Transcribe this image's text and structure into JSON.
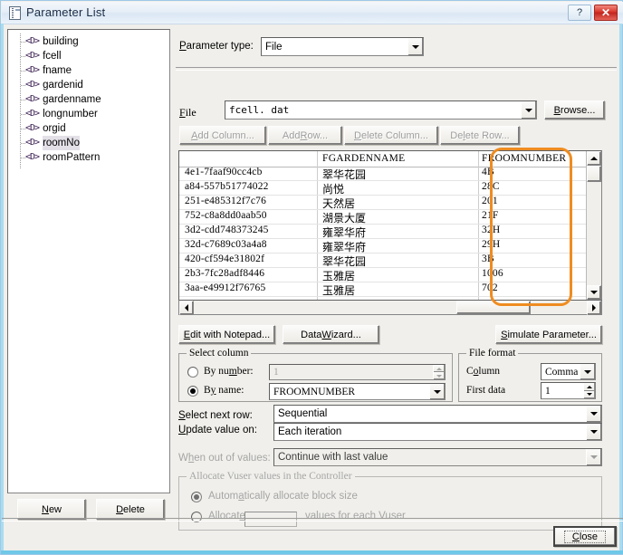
{
  "window": {
    "title": "Parameter List",
    "icon": "parameter-list-icon",
    "help_button": "?",
    "close_button": "✕"
  },
  "tree": {
    "items": [
      {
        "label": "building",
        "icon": "parameter-icon",
        "selected": false
      },
      {
        "label": "fcell",
        "icon": "parameter-icon",
        "selected": false
      },
      {
        "label": "fname",
        "icon": "parameter-icon",
        "selected": false
      },
      {
        "label": "gardenid",
        "icon": "parameter-icon",
        "selected": false
      },
      {
        "label": "gardenname",
        "icon": "parameter-icon",
        "selected": false
      },
      {
        "label": "longnumber",
        "icon": "parameter-icon",
        "selected": false
      },
      {
        "label": "orgid",
        "icon": "parameter-icon",
        "selected": false
      },
      {
        "label": "roomNo",
        "icon": "parameter-icon",
        "selected": true
      },
      {
        "label": "roomPattern",
        "icon": "parameter-icon",
        "selected": false
      }
    ],
    "icon_glyph": "<D>",
    "new_label": "New",
    "delete_label": "Delete"
  },
  "parameter_type": {
    "label": "Parameter type:",
    "value": "File"
  },
  "file_section": {
    "label": "File",
    "value": "fcell. dat",
    "browse_label": "Browse...",
    "buttons": [
      {
        "label": "Add Column...",
        "disabled": true
      },
      {
        "label": "Add Row...",
        "disabled": true
      },
      {
        "label": "Delete Column...",
        "disabled": true
      },
      {
        "label": "Delete Row...",
        "disabled": true
      }
    ]
  },
  "grid": {
    "columns": [
      "",
      "FGARDENNAME",
      "FROOMNUMBER"
    ],
    "highlight_column": "FGARDENNAME",
    "highlight_color": "#ef8c21",
    "rows": [
      [
        "4e1-7faaf90cc4cb",
        "翠华花园",
        "4B"
      ],
      [
        "a84-557b51774022",
        "尚悦",
        "28C"
      ],
      [
        "251-e485312f7c76",
        "天然居",
        "201"
      ],
      [
        "752-c8a8dd0aab50",
        "湖景大厦",
        "21F"
      ],
      [
        "3d2-cdd748373245",
        "雍翠华府",
        "32H"
      ],
      [
        "32d-c7689c03a4a8",
        "雍翠华府",
        "29H"
      ],
      [
        "420-cf594e31802f",
        "翠华花园",
        "3B"
      ],
      [
        "2b3-7fc28adf8446",
        "玉雅居",
        "1006"
      ],
      [
        "3aa-e49912f76765",
        "玉雅居",
        "702"
      ]
    ]
  },
  "actions": {
    "edit_notepad": "Edit with Notepad...",
    "data_wizard": "Data Wizard...",
    "simulate": "Simulate Parameter..."
  },
  "select_column": {
    "title": "Select column",
    "by_number_label": "By number:",
    "by_number_value": "1",
    "by_number_selected": false,
    "by_name_label": "By name:",
    "by_name_value": "FROOMNUMBER",
    "by_name_selected": true
  },
  "file_format": {
    "title": "File format",
    "column_label": "Column",
    "column_value": "Comma",
    "first_data_label": "First data",
    "first_data_value": "1"
  },
  "row_options": {
    "select_next_row_label": "Select next row:",
    "select_next_row_value": "Sequential",
    "update_value_label": "Update value on:",
    "update_value_value": "Each iteration",
    "when_out_label": "When out of values:",
    "when_out_value": "Continue with last value"
  },
  "allocate": {
    "title": "Allocate Vuser values in the Controller",
    "auto_label": "Automatically allocate block size",
    "auto_selected": true,
    "manual_label": "Allocate",
    "manual_value": "",
    "manual_suffix": "values for each Vuser",
    "manual_selected": false
  },
  "footer": {
    "close_label": "Close"
  }
}
